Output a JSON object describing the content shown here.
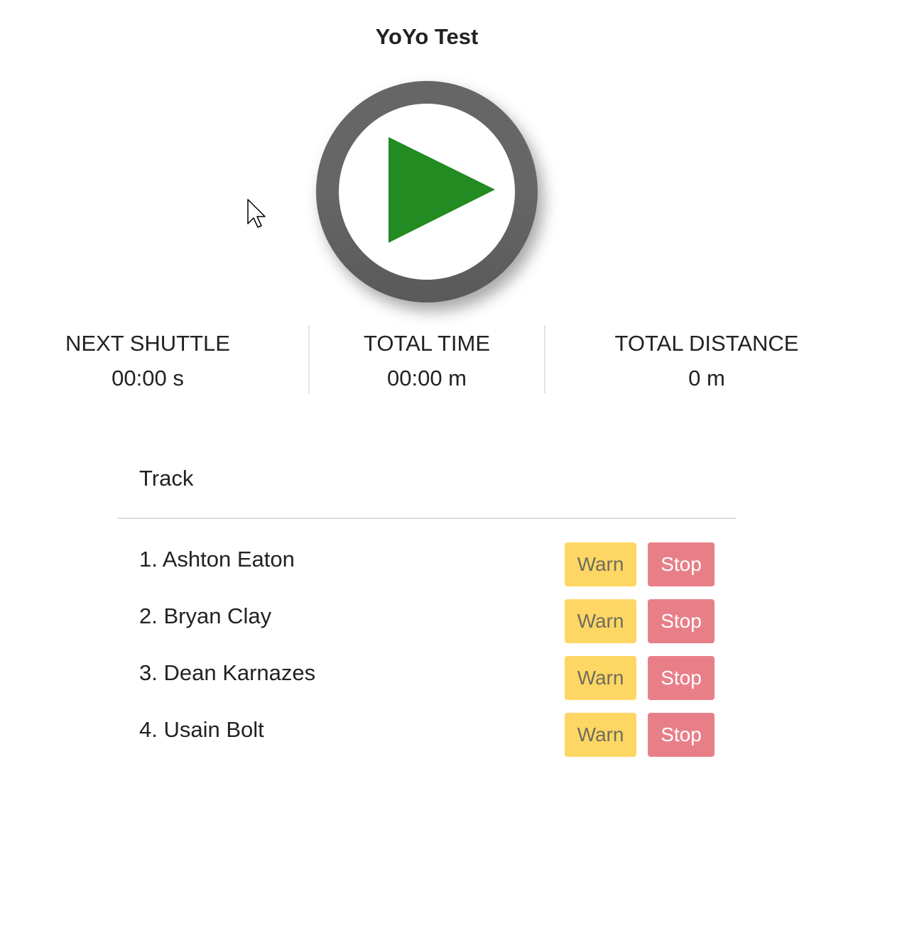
{
  "title": "YoYo Test",
  "play_button": {
    "icon": "play-icon",
    "ring_color": "#666666",
    "icon_color": "#228b22"
  },
  "stats": [
    {
      "label": "NEXT SHUTTLE",
      "value": "00:00 s"
    },
    {
      "label": "TOTAL TIME",
      "value": "00:00 m"
    },
    {
      "label": "TOTAL DISTANCE",
      "value": "0 m"
    }
  ],
  "track": {
    "heading": "Track",
    "athletes": [
      {
        "name": "1. Ashton Eaton",
        "warn_label": "Warn",
        "stop_label": "Stop"
      },
      {
        "name": "2. Bryan Clay",
        "warn_label": "Warn",
        "stop_label": "Stop"
      },
      {
        "name": "3. Dean Karnazes",
        "warn_label": "Warn",
        "stop_label": "Stop"
      },
      {
        "name": "4. Usain Bolt",
        "warn_label": "Warn",
        "stop_label": "Stop"
      }
    ]
  },
  "colors": {
    "warn": "#fed664",
    "stop": "#e87f88"
  }
}
